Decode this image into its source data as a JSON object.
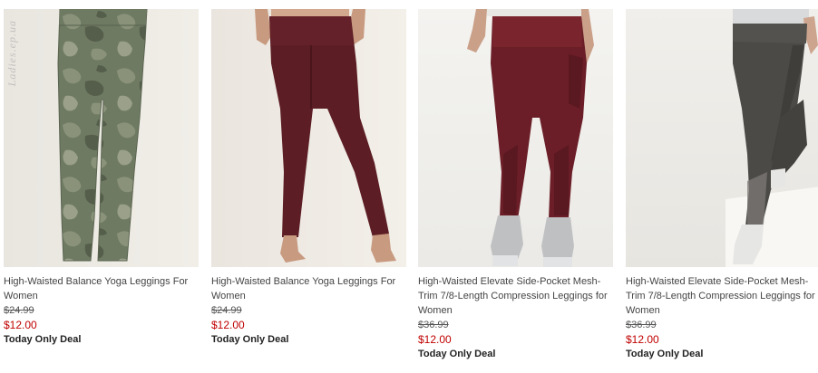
{
  "watermark": "Ladies.ep.ua",
  "products": [
    {
      "title": "High-Waisted Balance Yoga Leggings For Women",
      "original_price": "$24.99",
      "sale_price": "$12.00",
      "deal_label": "Today Only Deal"
    },
    {
      "title": "High-Waisted Balance Yoga Leggings For Women",
      "original_price": "$24.99",
      "sale_price": "$12.00",
      "deal_label": "Today Only Deal"
    },
    {
      "title": "High-Waisted Elevate Side-Pocket Mesh-Trim 7/8-Length Compression Leggings for Women",
      "original_price": "$36.99",
      "sale_price": "$12.00",
      "deal_label": "Today Only Deal"
    },
    {
      "title": "High-Waisted Elevate Side-Pocket Mesh-Trim 7/8-Length Compression Leggings for Women",
      "original_price": "$36.99",
      "sale_price": "$12.00",
      "deal_label": "Today Only Deal"
    }
  ],
  "colors": {
    "sale_price": "#c00000",
    "camo_green": "#6b7560",
    "burgundy": "#5c1d24",
    "charcoal": "#4a4946"
  }
}
